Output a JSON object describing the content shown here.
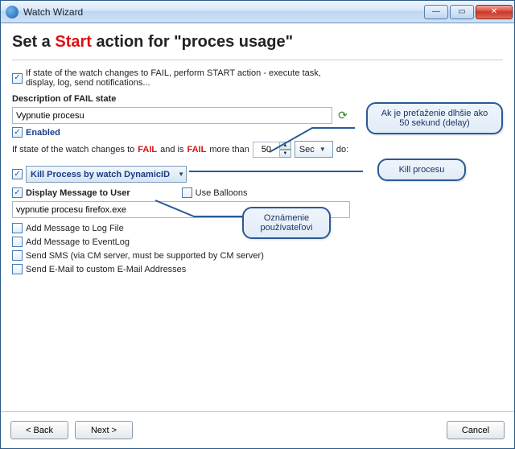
{
  "window": {
    "title": "Watch Wizard"
  },
  "heading": {
    "pre": "Set a ",
    "start": "Start",
    "post": " action for \"proces usage\""
  },
  "topCheck": {
    "label": "If state of the watch changes to FAIL, perform START action - execute task, display, log, send notifications..."
  },
  "desc": {
    "label": "Description of FAIL state",
    "value": "Vypnutie procesu"
  },
  "enabled": {
    "label": "Enabled"
  },
  "condition": {
    "pre": "If state of the watch changes to ",
    "fail1": "FAIL",
    "mid": " and is ",
    "fail2": "FAIL",
    "post": " more than ",
    "value": "50",
    "unit": "Sec",
    "do": "do:"
  },
  "action": {
    "label": "Kill Process by watch DynamicID"
  },
  "display": {
    "label": "Display Message to User",
    "balloons": "Use Balloons",
    "value": "vypnutie procesu firefox.exe"
  },
  "opts": {
    "logfile": "Add Message to Log File",
    "eventlog": "Add Message to EventLog",
    "sms": "Send SMS (via CM server, must be supported by CM server)",
    "email": "Send E-Mail to custom E-Mail Addresses"
  },
  "callouts": {
    "delay": "Ak je preťaženie dlhšie ako 50 sekund  (delay)",
    "kill": "Kill procesu",
    "notify": "Oznámenie používateľovi"
  },
  "buttons": {
    "back": "< Back",
    "next": "Next >",
    "cancel": "Cancel"
  },
  "colors": {
    "accent": "#1a5aa8",
    "fail": "#d11"
  }
}
